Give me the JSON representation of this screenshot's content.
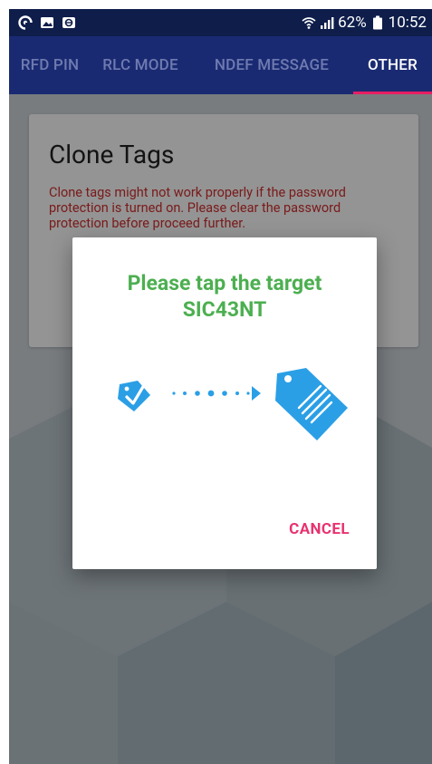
{
  "status_bar": {
    "battery": "62%",
    "time": "10:52",
    "left_icons": [
      "nfc-icon",
      "image-icon",
      "cast-icon"
    ],
    "right_icons": [
      "wifi-icon",
      "signal-icon",
      "battery-icon"
    ]
  },
  "tabs": [
    {
      "label": "RFD PIN",
      "active": false
    },
    {
      "label": "RLC MODE",
      "active": false
    },
    {
      "label": "NDEF MESSAGE",
      "active": false
    },
    {
      "label": "OTHER",
      "active": true
    }
  ],
  "card": {
    "title": "Clone Tags",
    "warning": "Clone tags might not work properly if the password protection is turned on. Please clear the password protection before proceed further."
  },
  "dialog": {
    "title_line1": "Please tap the target",
    "title_line2": "SIC43NT",
    "cancel_label": "CANCEL",
    "illustration_icons": [
      "source-tag-check-icon",
      "transfer-dots-arrow-icon",
      "target-tag-icon"
    ]
  },
  "colors": {
    "status_bar": "#0e1d4a",
    "tab_bar": "#1a2a72",
    "tab_indicator": "#e81e63",
    "dialog_title": "#4caf50",
    "cancel": "#e8336f",
    "warning": "#d32f2f",
    "tag_blue": "#2b9fe6"
  }
}
